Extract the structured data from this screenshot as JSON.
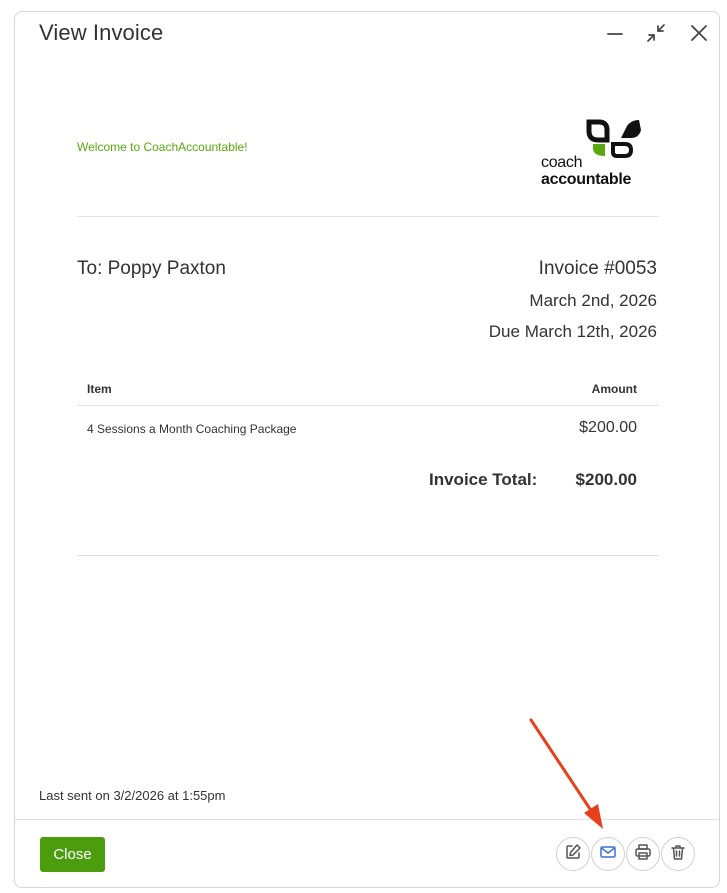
{
  "dialog": {
    "title": "View Invoice",
    "controls": {
      "minimize_icon": "minimize-icon",
      "restore_icon": "collapse-icon",
      "close_icon": "close-icon"
    }
  },
  "invoice": {
    "welcome_message": "Welcome to CoachAccountable!",
    "logo": {
      "line1": "coach",
      "line2": "accountable",
      "colors": {
        "black": "#111111",
        "green": "#5aa80e"
      }
    },
    "recipient": "To: Poppy Paxton",
    "number": "Invoice #0053",
    "date": "March 2nd, 2026",
    "due": "Due March 12th, 2026",
    "table": {
      "headers": {
        "item": "Item",
        "amount": "Amount"
      },
      "rows": [
        {
          "item": "4 Sessions a Month Coaching Package",
          "amount": "$200.00"
        }
      ],
      "total_label": "Invoice Total:",
      "total_value": "$200.00"
    }
  },
  "footer": {
    "last_sent": "Last sent on 3/2/2026 at 1:55pm",
    "close_label": "Close",
    "actions": [
      "edit-icon",
      "email-icon",
      "print-icon",
      "delete-icon"
    ]
  },
  "colors": {
    "accent_green": "#4c9d0e",
    "tagline_green": "#5aa80e",
    "email_blue": "#3a6fd8",
    "annotation_arrow": "#e8401c"
  }
}
